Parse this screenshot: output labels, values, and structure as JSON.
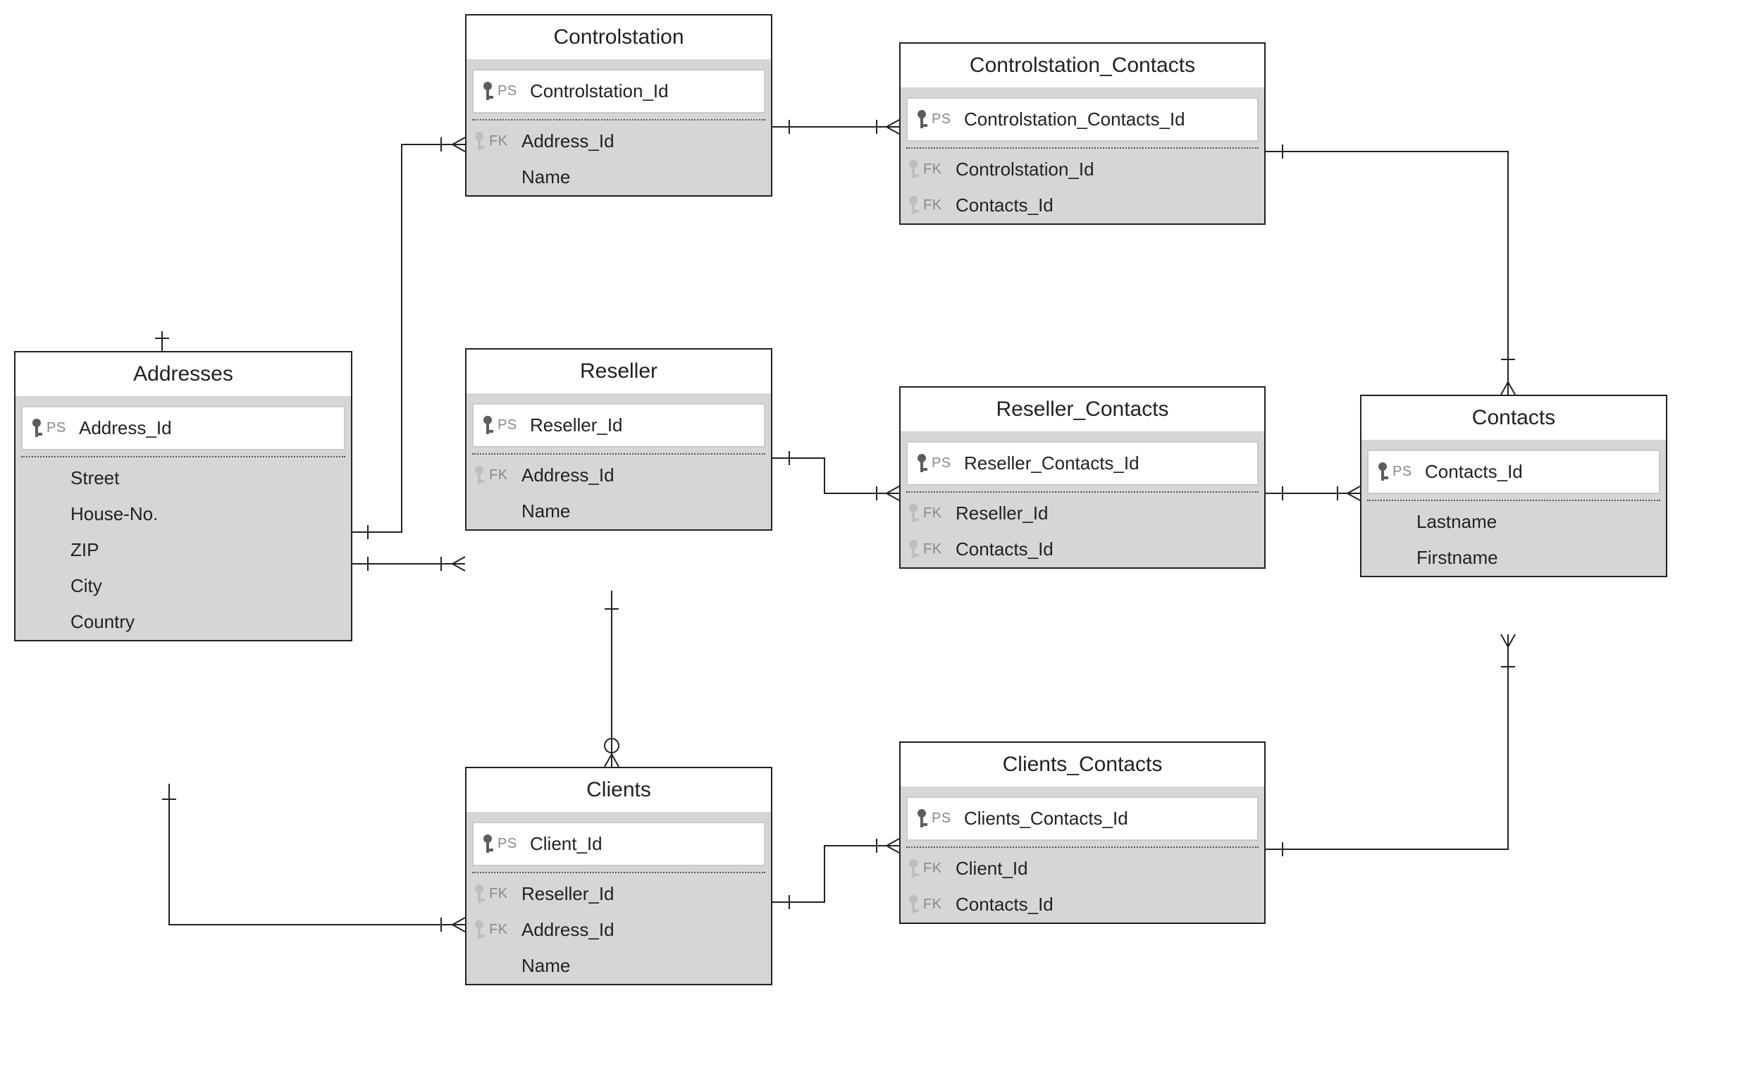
{
  "labels": {
    "ps": "PS",
    "fk": "FK"
  },
  "entities": {
    "addresses": {
      "title": "Addresses",
      "pk": {
        "label": "PS",
        "field": "Address_Id"
      },
      "fields": [
        {
          "label": "",
          "field": "Street"
        },
        {
          "label": "",
          "field": "House-No."
        },
        {
          "label": "",
          "field": "ZIP"
        },
        {
          "label": "",
          "field": "City"
        },
        {
          "label": "",
          "field": "Country"
        }
      ]
    },
    "controlstation": {
      "title": "Controlstation",
      "pk": {
        "label": "PS",
        "field": "Controlstation_Id"
      },
      "fields": [
        {
          "label": "FK",
          "field": "Address_Id"
        },
        {
          "label": "",
          "field": "Name"
        }
      ]
    },
    "controlstation_contacts": {
      "title": "Controlstation_Contacts",
      "pk": {
        "label": "PS",
        "field": "Controlstation_Contacts_Id"
      },
      "fields": [
        {
          "label": "FK",
          "field": "Controlstation_Id"
        },
        {
          "label": "FK",
          "field": "Contacts_Id"
        }
      ]
    },
    "reseller": {
      "title": "Reseller",
      "pk": {
        "label": "PS",
        "field": "Reseller_Id"
      },
      "fields": [
        {
          "label": "FK",
          "field": "Address_Id"
        },
        {
          "label": "",
          "field": "Name"
        }
      ]
    },
    "reseller_contacts": {
      "title": "Reseller_Contacts",
      "pk": {
        "label": "PS",
        "field": "Reseller_Contacts_Id"
      },
      "fields": [
        {
          "label": "FK",
          "field": "Reseller_Id"
        },
        {
          "label": "FK",
          "field": "Contacts_Id"
        }
      ]
    },
    "contacts": {
      "title": "Contacts",
      "pk": {
        "label": "PS",
        "field": "Contacts_Id"
      },
      "fields": [
        {
          "label": "",
          "field": "Lastname"
        },
        {
          "label": "",
          "field": "Firstname"
        }
      ]
    },
    "clients": {
      "title": "Clients",
      "pk": {
        "label": "PS",
        "field": "Client_Id"
      },
      "fields": [
        {
          "label": "FK",
          "field": "Reseller_Id"
        },
        {
          "label": "FK",
          "field": "Address_Id"
        },
        {
          "label": "",
          "field": "Name"
        }
      ]
    },
    "clients_contacts": {
      "title": "Clients_Contacts",
      "pk": {
        "label": "PS",
        "field": "Clients_Contacts_Id"
      },
      "fields": [
        {
          "label": "FK",
          "field": "Client_Id"
        },
        {
          "label": "FK",
          "field": "Contacts_Id"
        }
      ]
    }
  }
}
